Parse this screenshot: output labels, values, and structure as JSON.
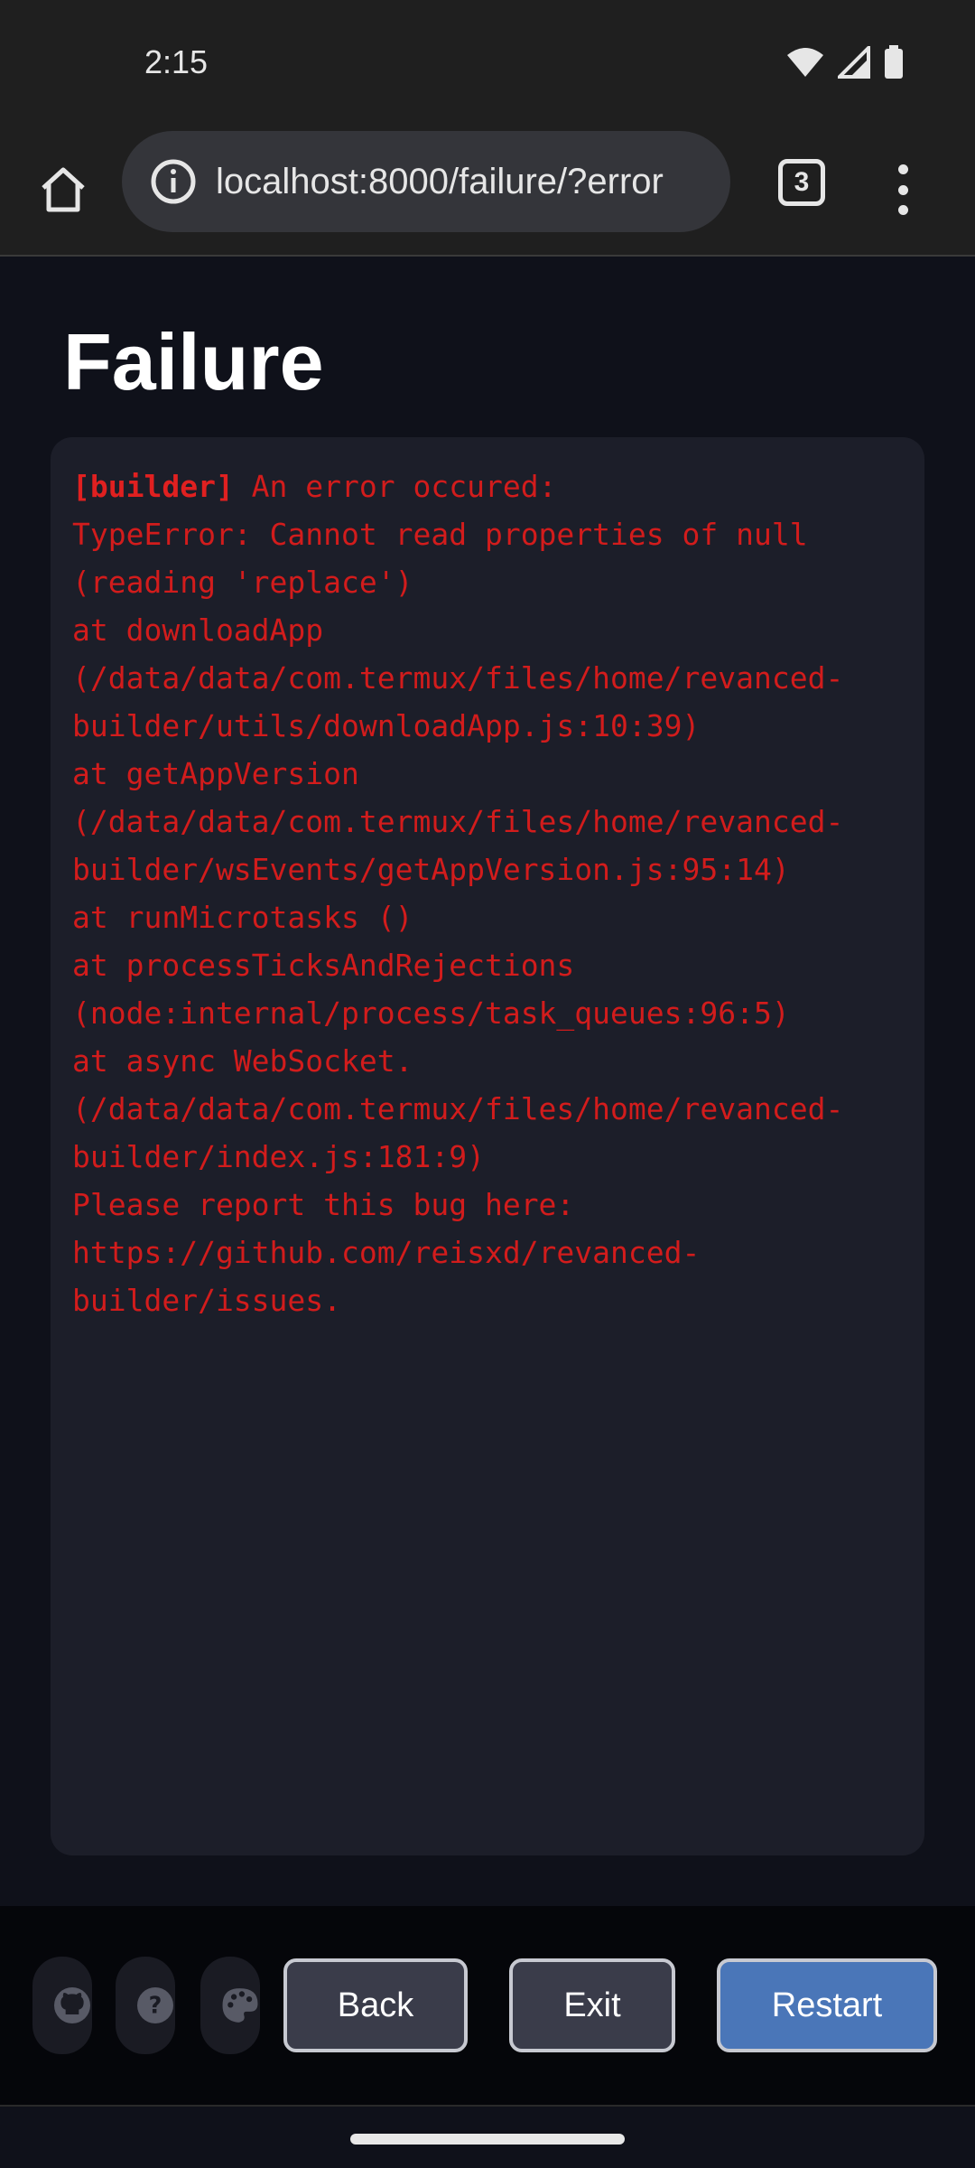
{
  "status_bar": {
    "time": "2:15"
  },
  "browser": {
    "url": "localhost:8000/failure/?error",
    "tab_count": "3"
  },
  "page": {
    "title": "Failure",
    "log": {
      "tag": "[builder]",
      "first_line_text": " An error occured:",
      "lines": [
        "TypeError: Cannot read properties of null",
        "(reading 'replace')",
        "at downloadApp",
        "(/data/data/com.termux/files/home/revanced-",
        "builder/utils/downloadApp.js:10:39)",
        "at getAppVersion",
        "(/data/data/com.termux/files/home/revanced-",
        "builder/wsEvents/getAppVersion.js:95:14)",
        "at runMicrotasks ()",
        "at processTicksAndRejections",
        "(node:internal/process/task_queues:96:5)",
        "at async WebSocket.",
        "(/data/data/com.termux/files/home/revanced-",
        "builder/index.js:181:9)",
        "Please report this bug here:",
        "https://github.com/reisxd/revanced-",
        "builder/issues."
      ]
    }
  },
  "footer": {
    "icons": [
      "github-icon",
      "help-icon",
      "palette-icon"
    ],
    "back_label": "Back",
    "exit_label": "Exit",
    "restart_label": "Restart"
  },
  "colors": {
    "error_text": "#d21c1c",
    "primary_button": "#4a76b8",
    "secondary_button": "#3a3c4a",
    "log_background": "#1c1e29"
  }
}
